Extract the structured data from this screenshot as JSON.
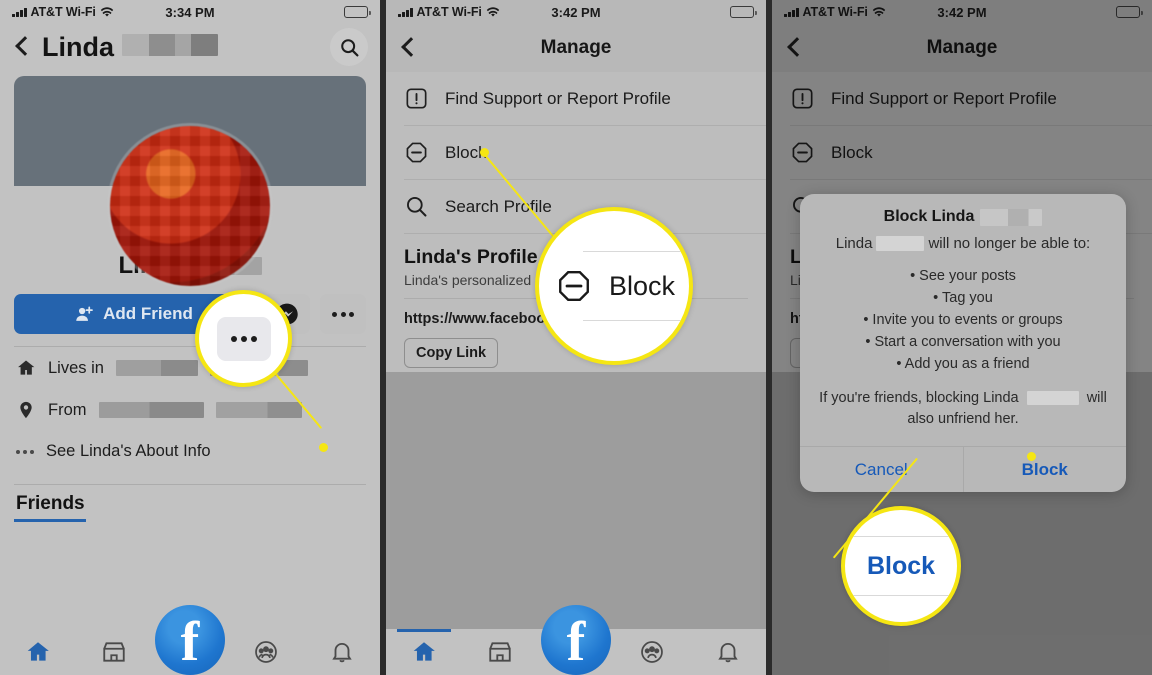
{
  "panels": [
    {
      "id": "profile",
      "status": {
        "carrier": "AT&T Wi-Fi",
        "time": "3:34 PM"
      },
      "nav": {
        "title": "Linda",
        "back_icon": "chevron-left-icon",
        "search_icon": "search-icon"
      },
      "profile": {
        "name": "Linda",
        "add_friend_label": "Add Friend",
        "messenger_icon": "messenger-icon",
        "more_icon": "ellipsis-icon",
        "info": [
          {
            "icon": "home-icon",
            "label": "Lives in"
          },
          {
            "icon": "location-pin-icon",
            "label": "From"
          },
          {
            "icon": "ellipsis-icon",
            "label": "See Linda's About Info"
          }
        ],
        "friends_heading": "Friends"
      },
      "callout": {
        "type": "ellipsis-button",
        "label": ""
      }
    },
    {
      "id": "manage",
      "status": {
        "carrier": "AT&T Wi-Fi",
        "time": "3:42 PM"
      },
      "nav": {
        "title": "Manage",
        "back_icon": "chevron-left-icon"
      },
      "rows": [
        {
          "icon": "exclamation-box-icon",
          "label": "Find Support or Report Profile"
        },
        {
          "icon": "block-octagon-icon",
          "label": "Block"
        },
        {
          "icon": "search-icon",
          "label": "Search Profile"
        }
      ],
      "link_card": {
        "title": "Linda's Profile Link",
        "subtitle": "Linda's personalized link",
        "url": "https://www.facebook.c",
        "copy_label": "Copy Link"
      },
      "callout": {
        "type": "block-row",
        "label": "Block",
        "icon": "block-octagon-icon"
      }
    },
    {
      "id": "manage-block-dialog",
      "status": {
        "carrier": "AT&T Wi-Fi",
        "time": "3:42 PM"
      },
      "nav": {
        "title": "Manage",
        "back_icon": "chevron-left-icon"
      },
      "rows": [
        {
          "icon": "exclamation-box-icon",
          "label": "Find Support or Report Profile"
        },
        {
          "icon": "block-octagon-icon",
          "label": "Block"
        },
        {
          "icon": "search-icon",
          "label": "Search Profile"
        }
      ],
      "dialog": {
        "title_prefix": "Block Linda",
        "lead_prefix": "Linda",
        "lead_suffix": "will no longer be able to:",
        "bullets": [
          "• See your posts",
          "• Tag you",
          "• Invite you to events or groups",
          "• Start a conversation with you",
          "• Add you as a friend"
        ],
        "footnote_prefix": "If you're friends, blocking Linda",
        "footnote_suffix": "will also unfriend her.",
        "cancel_label": "Cancel",
        "block_label": "Block"
      },
      "callout": {
        "type": "dialog-block-button",
        "label": "Block"
      }
    }
  ],
  "tabbar": {
    "items": [
      {
        "icon": "home-icon",
        "label": "Home"
      },
      {
        "icon": "marketplace-icon",
        "label": "Marketplace"
      },
      {
        "icon": "facebook-logo-icon",
        "label": "f"
      },
      {
        "icon": "groups-icon",
        "label": "Groups"
      },
      {
        "icon": "bell-icon",
        "label": "Notifications"
      }
    ]
  },
  "colors": {
    "accent_blue": "#2563ad",
    "link_blue": "#1659b8",
    "highlight_yellow": "#f5e613",
    "panel_bg": "#bdbdbd",
    "cover_gray": "#67717a"
  }
}
